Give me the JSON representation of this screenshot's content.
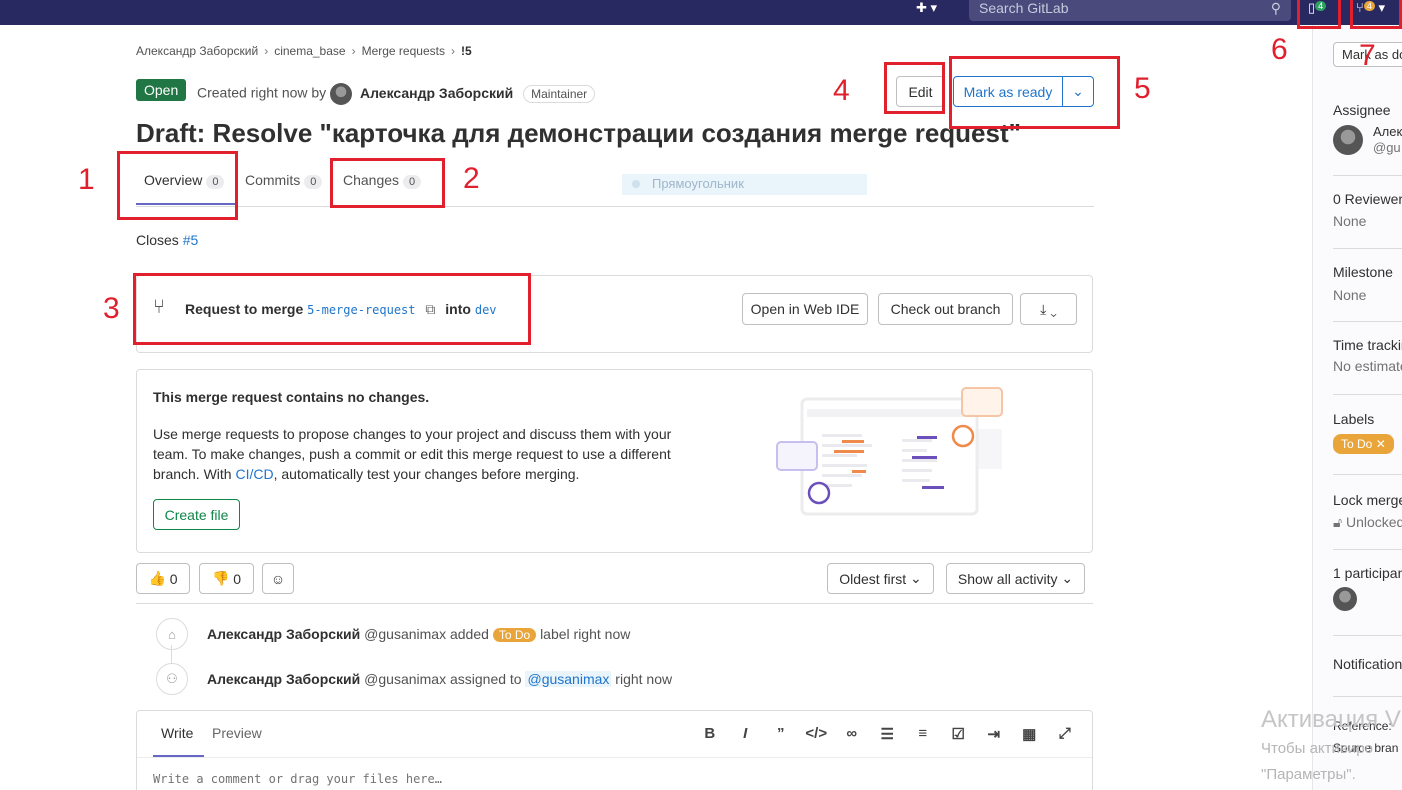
{
  "topbar": {
    "search_placeholder": "Search GitLab",
    "issues_count": "4",
    "mr_count": "4"
  },
  "breadcrumb": [
    "Александр Заборский",
    "cinema_base",
    "Merge requests",
    "!5"
  ],
  "header": {
    "status": "Open",
    "created_prefix": "Created right now by",
    "author": "Александр Заборский",
    "role": "Maintainer",
    "edit_label": "Edit",
    "mark_ready_label": "Mark as ready"
  },
  "title": "Draft: Resolve \"карточка для демонстрации создания merge request\"",
  "tabs": [
    {
      "label": "Overview",
      "count": "0"
    },
    {
      "label": "Commits",
      "count": "0"
    },
    {
      "label": "Changes",
      "count": "0"
    }
  ],
  "ghost_label": "Прямоугольник",
  "closes": {
    "prefix": "Closes",
    "issue": "#5"
  },
  "merge_widget": {
    "request_label": "Request to merge",
    "source_branch": "5-merge-request",
    "into_label": "into",
    "target_branch": "dev",
    "web_ide_label": "Open in Web IDE",
    "checkout_label": "Check out branch"
  },
  "no_changes": {
    "heading": "This merge request contains no changes.",
    "text_1": "Use merge requests to propose changes to your project and discuss them with your team. To make changes, push a commit or edit this merge request to use a different branch. With ",
    "cicd_link": "CI/CD",
    "text_2": ", automatically test your changes before merging.",
    "create_file_label": "Create file"
  },
  "reactions": {
    "thumbs_up": "0",
    "thumbs_down": "0"
  },
  "sort": {
    "order_label": "Oldest first",
    "filter_label": "Show all activity"
  },
  "activity": [
    {
      "author": "Александр Заборский",
      "handle": "@gusanimax",
      "action": "added",
      "label": "To Do",
      "suffix": "label right now"
    },
    {
      "author": "Александр Заборский",
      "handle": "@gusanimax",
      "action": "assigned to",
      "mention": "@gusanimax",
      "suffix": "right now"
    }
  ],
  "editor": {
    "write_label": "Write",
    "preview_label": "Preview",
    "placeholder": "Write a comment or drag your files here…"
  },
  "sidebar": {
    "mark_done": "Mark as done",
    "assignee_title": "Assignee",
    "assignee_name": "Алек",
    "assignee_handle": "@gu",
    "reviewers_title": "0 Reviewers",
    "reviewers_value": "None",
    "milestone_title": "Milestone",
    "milestone_value": "None",
    "time_title": "Time tracking",
    "time_value": "No estimate",
    "labels_title": "Labels",
    "label_value": "To Do",
    "lock_title": "Lock merge",
    "lock_value": "Unlocked",
    "participants_title": "1 participant",
    "notifications_title": "Notifications",
    "reference_title": "Reference:",
    "source_title": "Source bran"
  },
  "annotations": [
    "1",
    "2",
    "3",
    "4",
    "5",
    "6",
    "7"
  ],
  "watermark": {
    "line1": "Активация V",
    "line2": "Чтобы активиро",
    "line3": "\"Параметры\"."
  }
}
